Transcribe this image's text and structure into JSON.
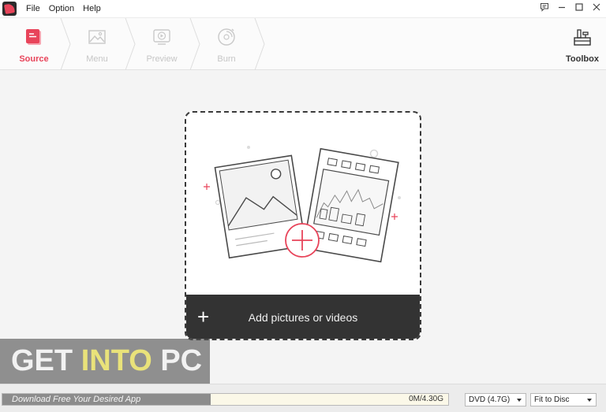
{
  "app": {
    "logo_icon": "app-logo-icon",
    "accent_color": "#e8445a"
  },
  "menu": {
    "items": [
      "File",
      "Option",
      "Help"
    ]
  },
  "window_controls": {
    "icons": [
      "feedback-icon",
      "minimize-icon",
      "maximize-icon",
      "close-icon"
    ]
  },
  "steps": [
    {
      "label": "Source",
      "icon": "document-icon",
      "active": true
    },
    {
      "label": "Menu",
      "icon": "image-icon",
      "active": false
    },
    {
      "label": "Preview",
      "icon": "play-icon",
      "active": false
    },
    {
      "label": "Burn",
      "icon": "disc-icon",
      "active": false
    }
  ],
  "toolbox": {
    "label": "Toolbox",
    "icon": "toolbox-icon"
  },
  "dropzone": {
    "add_label": "Add pictures or videos",
    "add_icon": "plus-icon",
    "illustration_icons": [
      "photo-icon",
      "film-strip-icon",
      "add-circle-icon"
    ]
  },
  "watermark": {
    "part1": "GET ",
    "part2": "INTO",
    "part3": " PC"
  },
  "status": {
    "tagline": "Download Free Your Desired App",
    "capacity": "0M/4.30G",
    "disc_type": "DVD (4.7G)",
    "fit_mode": "Fit to Disc"
  }
}
